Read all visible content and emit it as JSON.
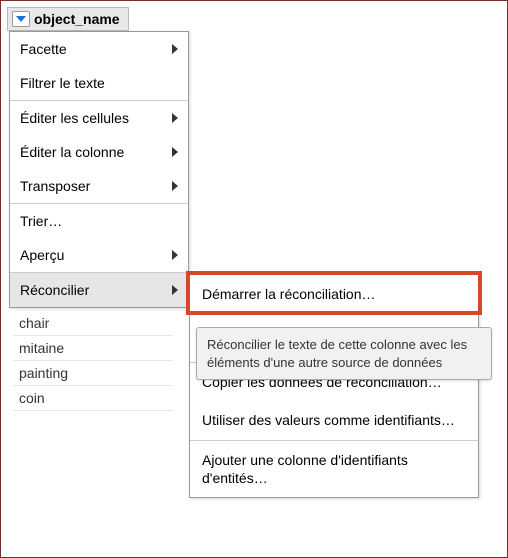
{
  "column": {
    "name": "object_name"
  },
  "menu": {
    "items": [
      {
        "label": "Facette",
        "has_submenu": true
      },
      {
        "label": "Filtrer le texte",
        "has_submenu": false
      },
      {
        "sep": true
      },
      {
        "label": "Éditer les cellules",
        "has_submenu": true
      },
      {
        "label": "Éditer la colonne",
        "has_submenu": true
      },
      {
        "label": "Transposer",
        "has_submenu": true
      },
      {
        "sep": true
      },
      {
        "label": "Trier…",
        "has_submenu": false
      },
      {
        "label": "Aperçu",
        "has_submenu": true
      },
      {
        "sep": true
      },
      {
        "label": "Réconcilier",
        "has_submenu": true,
        "highlighted": true
      }
    ]
  },
  "data_rows": [
    "chair",
    "mitaine",
    "painting",
    "coin"
  ],
  "submenu": {
    "items": [
      {
        "label": "Démarrer la réconciliation…",
        "highlighted": true
      },
      {
        "sep": true
      },
      {
        "label": "Copier les données de réconciliation…"
      },
      {
        "label": "Utiliser des valeurs comme identifiants…"
      },
      {
        "sep": true
      },
      {
        "label": "Ajouter une colonne d'identifiants d'entités…"
      }
    ]
  },
  "tooltip": {
    "text": "Réconcilier le texte de cette colonne avec les éléments d'une autre source de données"
  }
}
